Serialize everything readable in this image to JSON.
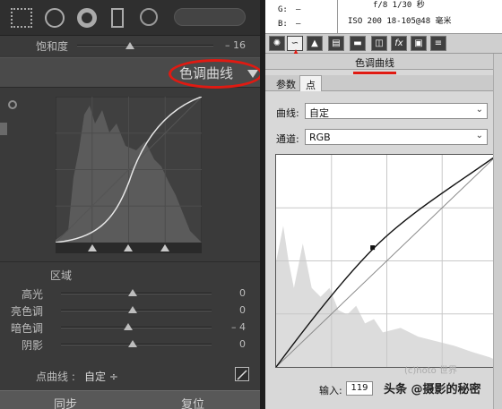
{
  "left_panel": {
    "saturation": {
      "label": "饱和度",
      "value": "– 16",
      "level": 0.42
    },
    "section_title": "色调曲线",
    "region_label": "区域",
    "sliders": [
      {
        "label": "高光",
        "value": "0",
        "level": 0.5
      },
      {
        "label": "亮色调",
        "value": "0",
        "level": 0.5
      },
      {
        "label": "暗色调",
        "value": "– 4",
        "level": 0.47
      },
      {
        "label": "阴影",
        "value": "0",
        "level": 0.5
      }
    ],
    "point_curve": {
      "label": "点曲线 :",
      "value": "自定 ÷"
    },
    "bottom_buttons": {
      "sync": "同步",
      "reset": "复位"
    }
  },
  "right_panel": {
    "info": {
      "g_label": "G:",
      "g_val": "—",
      "b_label": "B:",
      "b_val": "—",
      "aperture_shutter": "f/8   1/30 秒",
      "iso_lens": "ISO 200   18-105@48 毫米"
    },
    "panel_title": "色调曲线",
    "tabs": [
      "参数",
      "点"
    ],
    "curve_label": "曲线:",
    "curve_value": "自定",
    "channel_label": "通道:",
    "channel_value": "RGB",
    "input_label": "输入:",
    "input_value": "119",
    "watermark": "头条 @摄影的秘密",
    "watermark_small": "(c)hoto 世界"
  },
  "colors": {
    "annotation": "#e01a12"
  }
}
